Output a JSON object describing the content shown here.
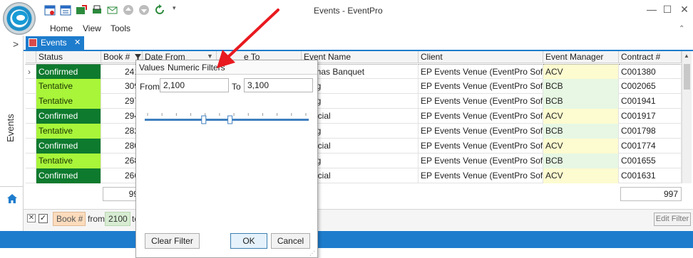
{
  "window": {
    "title": "Events - EventPro",
    "minimize": "—",
    "maximize": "☐",
    "close": "✕"
  },
  "menu": {
    "home": "Home",
    "view": "View",
    "tools": "Tools"
  },
  "sidebar": {
    "label": "Events",
    "expand": ">",
    "home_icon": "home-icon"
  },
  "tab": {
    "label": "Events",
    "close": "✕"
  },
  "columns": {
    "status": "Status",
    "book": "Book #",
    "date_from": "Date From",
    "date_to": "e To",
    "event_name": "Event Name",
    "client": "Client",
    "manager": "Event Manager",
    "contract": "Contract #"
  },
  "rows": [
    {
      "status": "Confirmed",
      "book": "241",
      "event": "stmas Banquet",
      "client": "EP Events Venue (EventPro Soft...",
      "manager": "ACV",
      "contract": "C001380"
    },
    {
      "status": "Tentative",
      "book": "309",
      "event": "ting",
      "client": "EP Events Venue (EventPro Soft...",
      "manager": "BCB",
      "contract": "C002065"
    },
    {
      "status": "Tentative",
      "book": "297",
      "event": "ting",
      "client": "EP Events Venue (EventPro Soft...",
      "manager": "BCB",
      "contract": "C001941"
    },
    {
      "status": "Confirmed",
      "book": "294",
      "event": "Social",
      "client": "EP Events Venue (EventPro Soft...",
      "manager": "ACV",
      "contract": "C001917"
    },
    {
      "status": "Tentative",
      "book": "282",
      "event": "ting",
      "client": "EP Events Venue (EventPro Soft...",
      "manager": "BCB",
      "contract": "C001798"
    },
    {
      "status": "Confirmed",
      "book": "280",
      "event": "Social",
      "client": "EP Events Venue (EventPro Soft...",
      "manager": "ACV",
      "contract": "C001774"
    },
    {
      "status": "Tentative",
      "book": "268",
      "event": "ting",
      "client": "EP Events Venue (EventPro Soft...",
      "manager": "BCB",
      "contract": "C001655"
    },
    {
      "status": "Confirmed",
      "book": "266",
      "event": "Social",
      "client": "EP Events Venue (EventPro Soft...",
      "manager": "ACV",
      "contract": "C001631"
    }
  ],
  "summary": {
    "book_count": "99",
    "contract_count": "997"
  },
  "filter_bar": {
    "field": "Book #",
    "from_label": "from",
    "from_value": "2100",
    "to_label": "to",
    "edit_filter": "Edit Filter"
  },
  "popup": {
    "tab_values": "Values",
    "tab_numeric": "Numeric Filters",
    "from_label": "From",
    "from_value": "2,100",
    "to_label": "To",
    "to_value": "3,100",
    "range_low_fraction": 0.36,
    "range_high_fraction": 0.52,
    "clear_filter": "Clear Filter",
    "ok": "OK",
    "cancel": "Cancel"
  },
  "colors": {
    "accent": "#1e7ccd",
    "confirmed": "#0e7a2e",
    "tentative": "#a8f53a",
    "annotation_arrow": "#e8191f"
  }
}
